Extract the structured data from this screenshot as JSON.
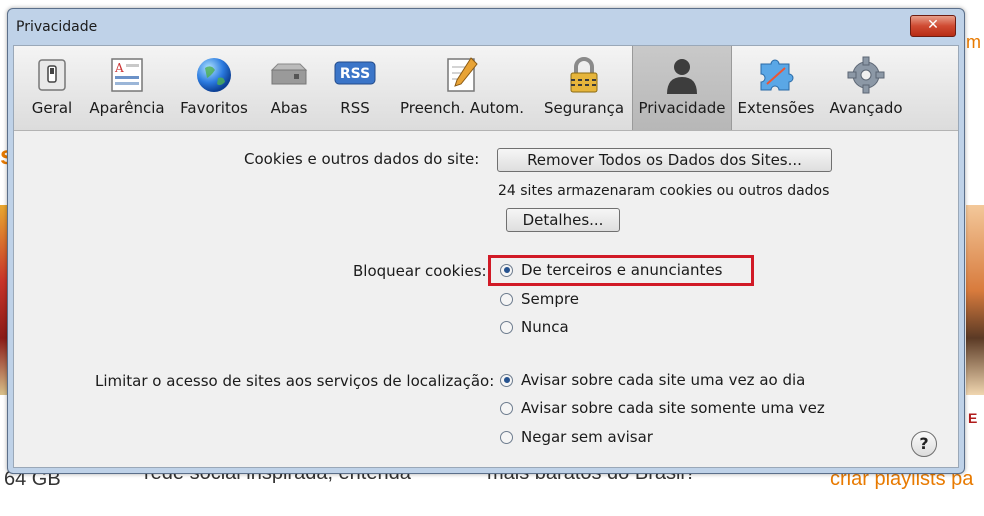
{
  "background": {
    "left_bottom_text": "64 GB",
    "middle_bottom_text_1": "rede social inspirada, entenda",
    "middle_bottom_text_2": "mais baratos do Brasil?",
    "right_bottom_text": "criar playlists pa",
    "right_top_text": "m",
    "right_label": "E",
    "left_orange_fragment": "s"
  },
  "window": {
    "title": "Privacidade",
    "close_symbol": "✕"
  },
  "toolbar": {
    "items": [
      {
        "label": "Geral",
        "icon": "switch-icon"
      },
      {
        "label": "Aparência",
        "icon": "appearance-icon"
      },
      {
        "label": "Favoritos",
        "icon": "globe-icon"
      },
      {
        "label": "Abas",
        "icon": "tabs-icon"
      },
      {
        "label": "RSS",
        "icon": "rss-icon"
      },
      {
        "label": "Preench. Autom.",
        "icon": "autofill-icon"
      },
      {
        "label": "Segurança",
        "icon": "lock-icon"
      },
      {
        "label": "Privacidade",
        "icon": "person-silhouette-icon",
        "selected": true
      },
      {
        "label": "Extensões",
        "icon": "puzzle-icon"
      },
      {
        "label": "Avançado",
        "icon": "gear-icon"
      }
    ],
    "rss_badge": "RSS"
  },
  "cookies": {
    "label": "Cookies e outros dados do site:",
    "remove_all_button": "Remover Todos os Dados dos Sites...",
    "status": "24 sites armazenaram cookies ou outros dados",
    "details_button": "Detalhes..."
  },
  "block_cookies": {
    "label": "Bloquear cookies:",
    "options": [
      {
        "label": "De terceiros e anunciantes",
        "checked": true
      },
      {
        "label": "Sempre",
        "checked": false
      },
      {
        "label": "Nunca",
        "checked": false
      }
    ]
  },
  "location": {
    "label": "Limitar o acesso de sites aos serviços de localização:",
    "options": [
      {
        "label": "Avisar sobre cada site uma vez ao dia",
        "checked": true
      },
      {
        "label": "Avisar sobre cada site somente uma vez",
        "checked": false
      },
      {
        "label": "Negar sem avisar",
        "checked": false
      }
    ]
  },
  "help_button": "?",
  "colors": {
    "highlight": "#d11a26",
    "accent_orange": "#e87a00"
  }
}
